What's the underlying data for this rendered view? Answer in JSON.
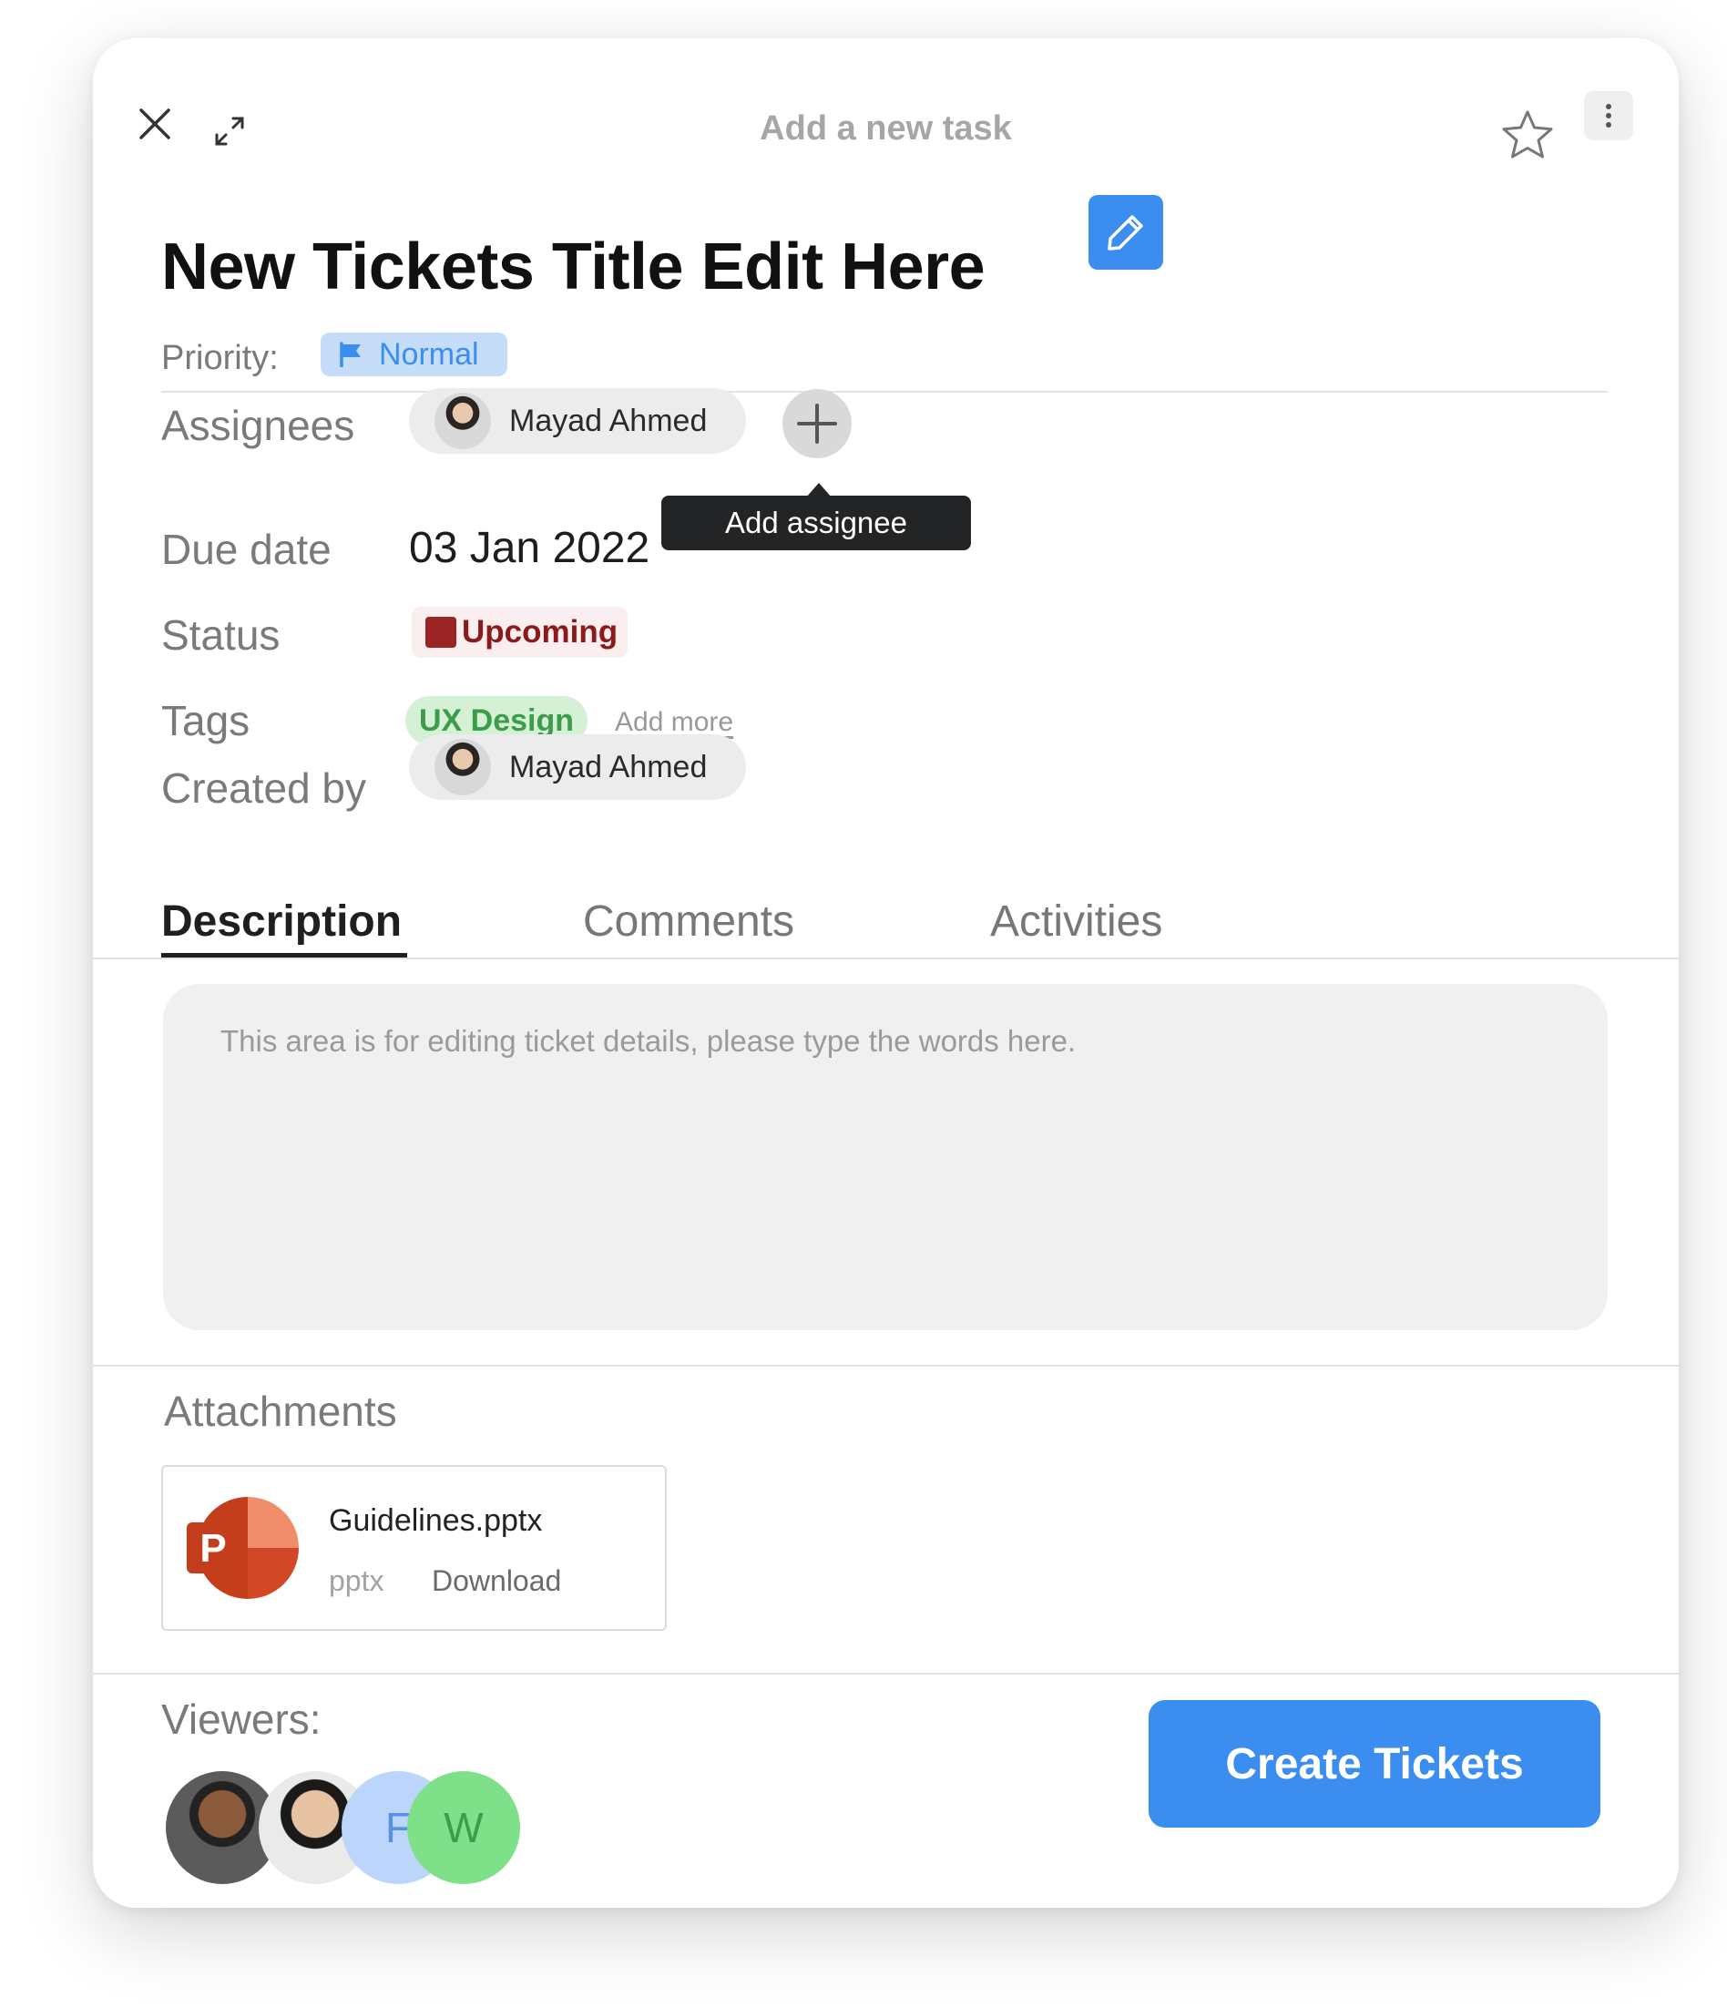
{
  "header": {
    "title": "Add a new task",
    "close_icon": "close-icon",
    "expand_icon": "expand-icon",
    "star_icon": "star-icon",
    "more_icon": "more-vertical-icon"
  },
  "ticket": {
    "title": "New Tickets Title Edit Here",
    "edit_icon": "pencil-icon",
    "priority_label": "Priority:",
    "priority_value": "Normal"
  },
  "fields": {
    "assignees_label": "Assignees",
    "assignee_name": "Mayad Ahmed",
    "add_assignee_tooltip": "Add assignee",
    "due_date_label": "Due date",
    "due_date_value": "03 Jan 2022",
    "status_label": "Status",
    "status_value": "Upcoming",
    "tags_label": "Tags",
    "tag_value": "UX Design",
    "add_more_label": "Add more",
    "created_by_label": "Created by",
    "created_by_name": "Mayad Ahmed"
  },
  "tabs": [
    {
      "label": "Description",
      "active": true
    },
    {
      "label": "Comments",
      "active": false
    },
    {
      "label": "Activities",
      "active": false
    }
  ],
  "description": {
    "placeholder": "This area is for editing ticket details, please type the words here."
  },
  "attachments": {
    "title": "Attachments",
    "file_name": "Guidelines.pptx",
    "file_type": "pptx",
    "download_label": "Download"
  },
  "viewers": {
    "label": "Viewers:",
    "initials": [
      "F",
      "W"
    ]
  },
  "actions": {
    "create_label": "Create Tickets"
  },
  "colors": {
    "accent": "#3b8ef0",
    "status": "#8b1a1a",
    "tag": "#3d9c4a"
  }
}
